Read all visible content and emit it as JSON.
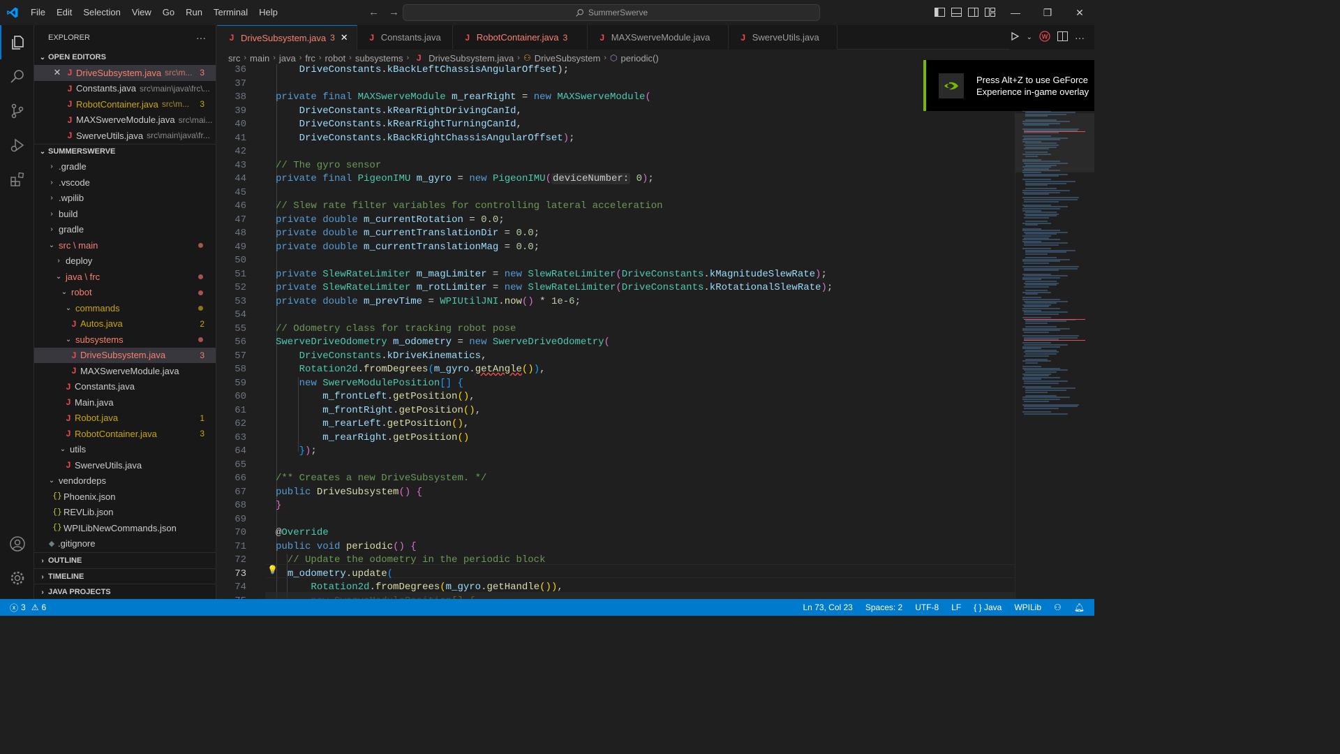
{
  "menu": [
    "File",
    "Edit",
    "Selection",
    "View",
    "Go",
    "Run",
    "Terminal",
    "Help"
  ],
  "search_placeholder": "SummerSwerve",
  "explorer": {
    "title": "EXPLORER",
    "more": "···",
    "open_editors_label": "OPEN EDITORS",
    "open_editors": [
      {
        "name": "DriveSubsystem.java",
        "path": "src\\m...",
        "badge": "3",
        "err": true
      },
      {
        "name": "Constants.java",
        "path": "src\\main\\java\\frc\\...",
        "badge": "",
        "err": false
      },
      {
        "name": "RobotContainer.java",
        "path": "src\\m...",
        "badge": "3",
        "err": true
      },
      {
        "name": "MAXSwerveModule.java",
        "path": "src\\mai...",
        "badge": "",
        "err": false
      },
      {
        "name": "SwerveUtils.java",
        "path": "src\\main\\java\\fr...",
        "badge": "",
        "err": false
      }
    ],
    "project_label": "SUMMERSWERVE",
    "tree": [
      {
        "name": ".gradle"
      },
      {
        "name": ".vscode"
      },
      {
        "name": ".wpilib"
      },
      {
        "name": "build"
      },
      {
        "name": "gradle"
      },
      {
        "name": "src \\ main"
      },
      {
        "name": "deploy"
      },
      {
        "name": "java \\ frc"
      },
      {
        "name": "robot"
      },
      {
        "name": "commands"
      },
      {
        "name": "Autos.java",
        "badge": "2"
      },
      {
        "name": "subsystems"
      },
      {
        "name": "DriveSubsystem.java",
        "badge": "3"
      },
      {
        "name": "MAXSwerveModule.java"
      },
      {
        "name": "Constants.java"
      },
      {
        "name": "Main.java"
      },
      {
        "name": "Robot.java",
        "badge": "1"
      },
      {
        "name": "RobotContainer.java",
        "badge": "3"
      },
      {
        "name": "utils"
      },
      {
        "name": "SwerveUtils.java"
      },
      {
        "name": "vendordeps"
      },
      {
        "name": "Phoenix.json"
      },
      {
        "name": "REVLib.json"
      },
      {
        "name": "WPILibNewCommands.json"
      },
      {
        "name": ".gitignore"
      }
    ],
    "outline_label": "OUTLINE",
    "timeline_label": "TIMELINE",
    "java_projects_label": "JAVA PROJECTS"
  },
  "tabs": [
    {
      "name": "DriveSubsystem.java",
      "badge": "3"
    },
    {
      "name": "Constants.java",
      "badge": ""
    },
    {
      "name": "RobotContainer.java",
      "badge": "3"
    },
    {
      "name": "MAXSwerveModule.java",
      "badge": ""
    },
    {
      "name": "SwerveUtils.java",
      "badge": ""
    }
  ],
  "breadcrumb": [
    "src",
    "main",
    "java",
    "frc",
    "robot",
    "subsystems",
    "DriveSubsystem.java",
    "DriveSubsystem",
    "periodic()"
  ],
  "editor": {
    "line_numbers": [
      "36",
      "37",
      "38",
      "39",
      "40",
      "41",
      "42",
      "43",
      "44",
      "45",
      "46",
      "47",
      "48",
      "49",
      "50",
      "51",
      "52",
      "53",
      "54",
      "55",
      "56",
      "57",
      "58",
      "59",
      "60",
      "61",
      "62",
      "63",
      "64",
      "65",
      "66",
      "67",
      "68",
      "69",
      "70",
      "71",
      "72",
      "73",
      "74",
      "75"
    ],
    "current_line": "73"
  },
  "overlay": {
    "text": "Press Alt+Z to use GeForce Experience in-game overlay"
  },
  "status": {
    "errors": "3",
    "warnings": "6",
    "position": "Ln 73, Col 23",
    "spaces": "Spaces: 2",
    "encoding": "UTF-8",
    "eol": "LF",
    "language": "Java",
    "wpilib": "WPILib"
  },
  "colors": {
    "accent": "#007acc",
    "error": "#f88070",
    "warning": "#cca700",
    "nvidia": "#76b900"
  }
}
